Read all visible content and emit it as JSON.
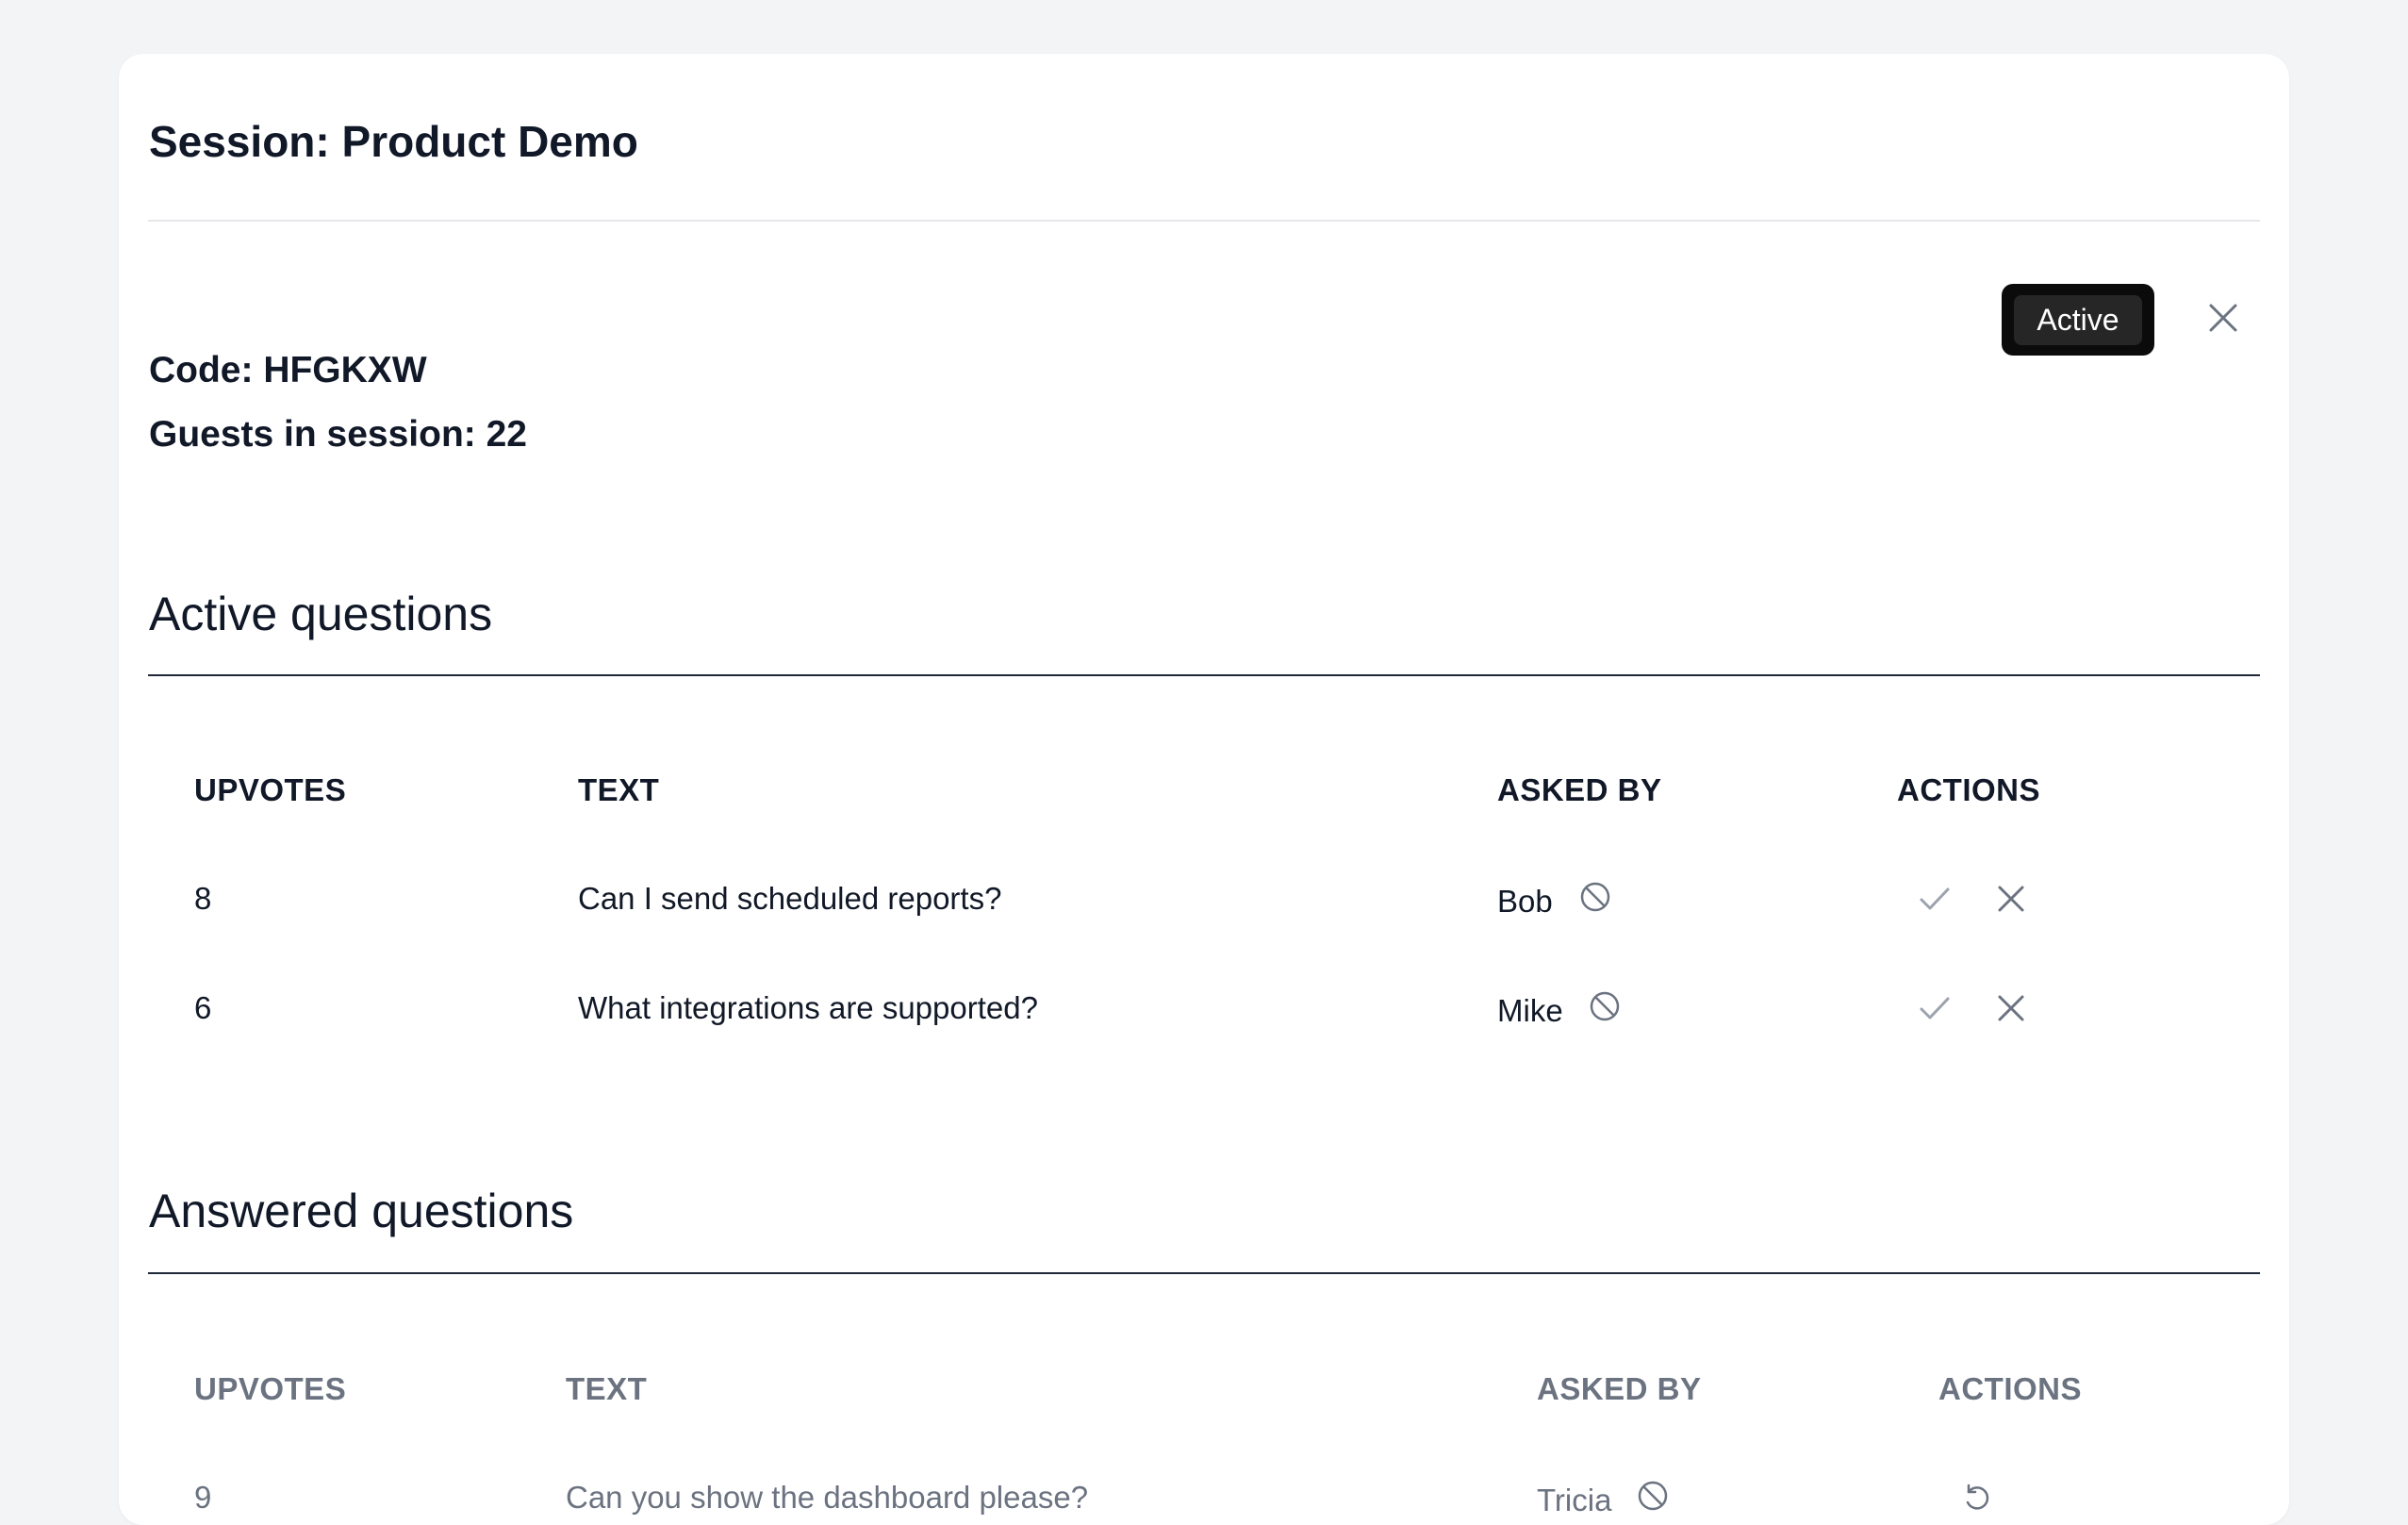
{
  "session": {
    "title": "Session: Product Demo",
    "code": "Code: HFGKXW",
    "guests": "Guests in session: 22",
    "status_label": "Active"
  },
  "active_questions": {
    "heading": "Active questions",
    "columns": [
      "UPVOTES",
      "TEXT",
      "ASKED BY",
      "ACTIONS"
    ],
    "rows": [
      {
        "upvotes": "8",
        "text": "Can I send scheduled reports?",
        "asked_by": "Bob"
      },
      {
        "upvotes": "6",
        "text": "What integrations are supported?",
        "asked_by": "Mike"
      }
    ]
  },
  "answered_questions": {
    "heading": "Answered questions",
    "columns": [
      "UPVOTES",
      "TEXT",
      "ASKED BY",
      "ACTIONS"
    ],
    "rows": [
      {
        "upvotes": "9",
        "text": "Can you show the dashboard please?",
        "asked_by": "Tricia"
      }
    ]
  },
  "icons": {
    "close": "close-icon",
    "ban": "ban-icon",
    "approve": "check-icon",
    "dismiss": "x-icon",
    "restore": "undo-icon"
  },
  "colors": {
    "background": "#f3f4f6",
    "card": "#ffffff",
    "text_dark": "#111827",
    "text_muted": "#6b7280",
    "status_button": "#0b0b0b",
    "icon_gray": "#9ca3af"
  }
}
